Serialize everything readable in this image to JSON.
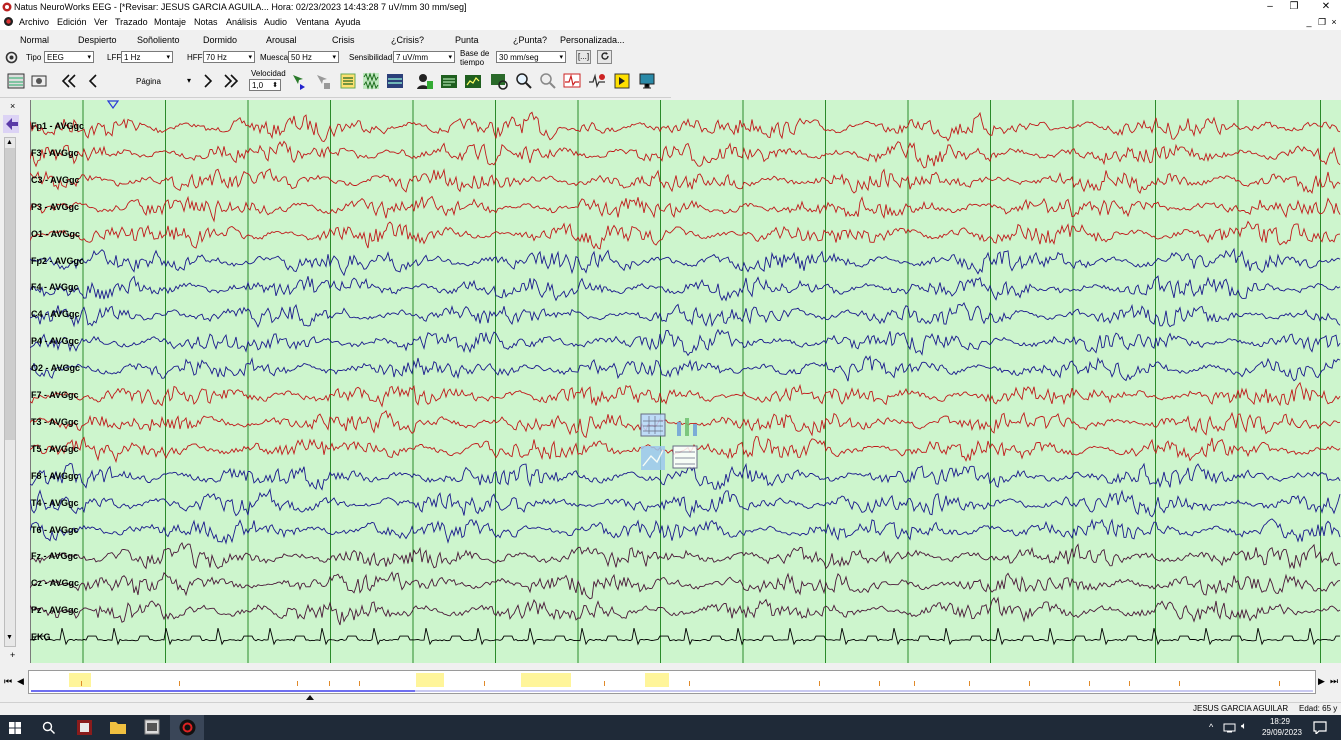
{
  "window": {
    "title": "Natus NeuroWorks EEG - [*Revisar:  JESUS  GARCIA AGUILA...  Hora: 02/23/2023 14:43:28   7 uV/mm   30 mm/seg]",
    "minimize": "–",
    "restore": "❐",
    "close": "✕"
  },
  "menu": {
    "items": [
      "Archivo",
      "Edición",
      "Ver",
      "Trazado",
      "Montaje",
      "Notas",
      "Análisis",
      "Audio",
      "Ventana",
      "Ayuda"
    ],
    "mdi_min": "_",
    "mdi_restore": "❐",
    "mdi_close": "×"
  },
  "presets": [
    "Normal",
    "Despierto",
    "Soñoliento",
    "Dormido",
    "Arousal",
    "Crisis",
    "¿Crisis?",
    "Punta",
    "¿Punta?",
    "Personalizada..."
  ],
  "settings": {
    "tipo_label": "Tipo",
    "tipo_value": "EEG",
    "lff_label": "LFF",
    "lff_value": "1 Hz",
    "hff_label": "HFF",
    "hff_value": "70 Hz",
    "muesca_label": "Muesca",
    "muesca_value": "50 Hz",
    "sensibilidad_label": "Sensibilidad",
    "sensibilidad_value": "7 uV/mm",
    "base_label": "Base de tiempo",
    "base_value": "30 mm/seg",
    "bracket_btn": "[...]"
  },
  "toolbar": {
    "page_label": "Página",
    "velocidad_label": "Velocidad",
    "velocidad_value": "1,0"
  },
  "channels": [
    {
      "label": "Fp1 - AVGgc",
      "color": "#c01a1a"
    },
    {
      "label": "F3 - AVGgc",
      "color": "#c01a1a"
    },
    {
      "label": "C3 - AVGgc",
      "color": "#c01a1a"
    },
    {
      "label": "P3 - AVGgc",
      "color": "#c01a1a"
    },
    {
      "label": "O1 - AVGgc",
      "color": "#c01a1a"
    },
    {
      "label": "Fp2 - AVGgc",
      "color": "#1a1a8c"
    },
    {
      "label": "F4 - AVGgc",
      "color": "#1a1a8c"
    },
    {
      "label": "C4 - AVGgc",
      "color": "#1a1a8c"
    },
    {
      "label": "P4 - AVGgc",
      "color": "#1a1a8c"
    },
    {
      "label": "O2 - AVGgc",
      "color": "#1a1a8c"
    },
    {
      "label": "F7 - AVGgc",
      "color": "#c01a1a"
    },
    {
      "label": "T3 - AVGgc",
      "color": "#c01a1a"
    },
    {
      "label": "T5 - AVGgc",
      "color": "#c01a1a"
    },
    {
      "label": "F8 - AVGgc",
      "color": "#1a1a8c"
    },
    {
      "label": "T4 - AVGgc",
      "color": "#1a1a8c"
    },
    {
      "label": "T6 - AVGgc",
      "color": "#1a1a8c"
    },
    {
      "label": "Fz - AVGgc",
      "color": "#4a1838"
    },
    {
      "label": "Cz - AVGgc",
      "color": "#4a1838"
    },
    {
      "label": "Pz - AVGgc",
      "color": "#4a1838"
    },
    {
      "label": "EKG",
      "color": "#000000"
    }
  ],
  "graph": {
    "background": "#cdf5cd",
    "second_line_color": "#2a8a2a"
  },
  "status": {
    "patient": "JESUS  GARCIA AGUILAR",
    "age": "Edad: 65 y"
  },
  "taskbar": {
    "time": "18:29",
    "date": "29/09/2023"
  }
}
